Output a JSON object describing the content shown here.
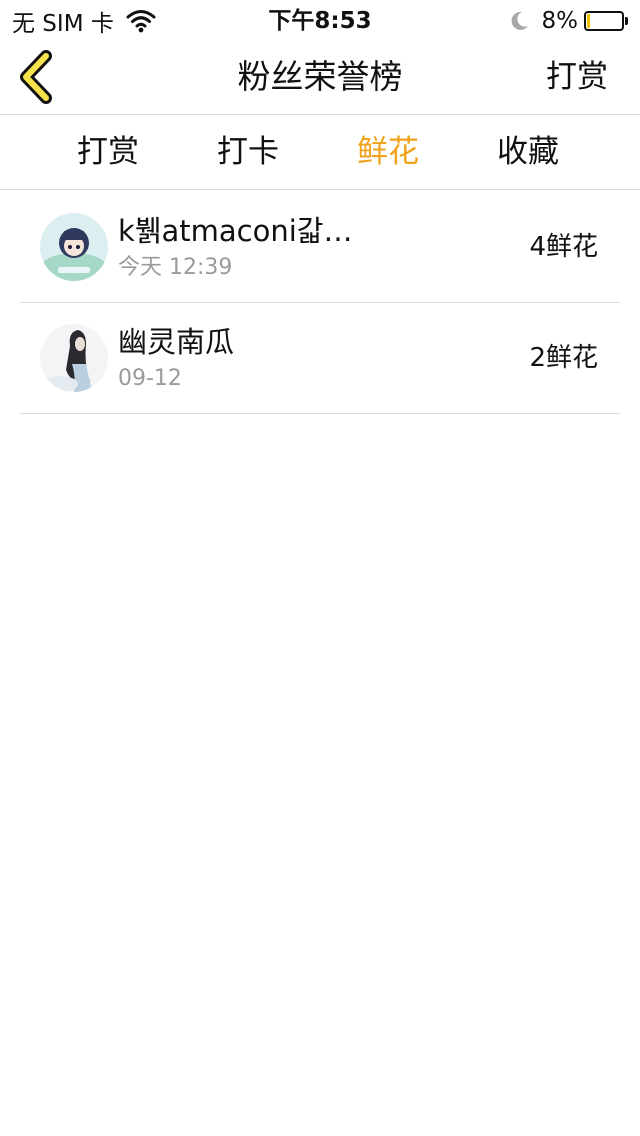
{
  "status_bar": {
    "carrier": "无 SIM 卡",
    "time": "下午8:53",
    "battery_text": "8%",
    "battery_level": 0.08,
    "icons": [
      "wifi-icon",
      "moon-icon",
      "battery-icon"
    ]
  },
  "nav": {
    "title": "粉丝荣誉榜",
    "action_label": "打赏",
    "back_icon": "chevron-left-icon",
    "accent_color": "#f3c200"
  },
  "tabs": [
    {
      "label": "打赏",
      "active": false
    },
    {
      "label": "打卡",
      "active": false
    },
    {
      "label": "鲜花",
      "active": true
    },
    {
      "label": "收藏",
      "active": false
    }
  ],
  "active_tab_color": "#f0a21a",
  "list": [
    {
      "name": "k뷁atmaconi갋…",
      "time": "今天 12:39",
      "count": "4鲜花",
      "avatar": "avatar-anime-girl"
    },
    {
      "name": "幽灵南瓜",
      "time": "09-12",
      "count": "2鲜花",
      "avatar": "avatar-person"
    }
  ]
}
